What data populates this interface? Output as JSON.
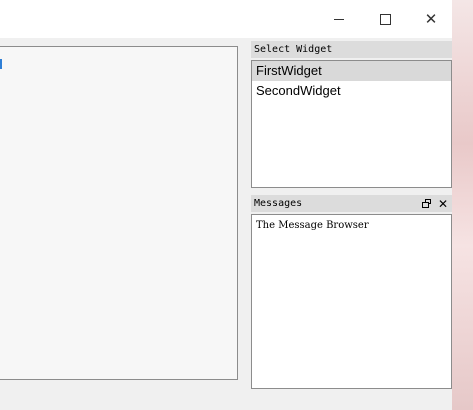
{
  "window": {
    "controls": {
      "minimize_icon": "minimize-icon",
      "maximize_icon": "maximize-icon",
      "close_icon": "close-icon",
      "close_glyph": "✕"
    }
  },
  "docks": {
    "select_widget": {
      "title": "Select Widget",
      "items": [
        "FirstWidget",
        "SecondWidget"
      ],
      "selected_index": 0
    },
    "messages": {
      "title": "Messages",
      "float_icon": "float-icon",
      "close_glyph": "✕",
      "text": "The Message Browser"
    }
  },
  "colors": {
    "accent": "#2f7fd6",
    "selection": "#d9d9d9",
    "dock_title_bg": "#dcdcdc"
  }
}
